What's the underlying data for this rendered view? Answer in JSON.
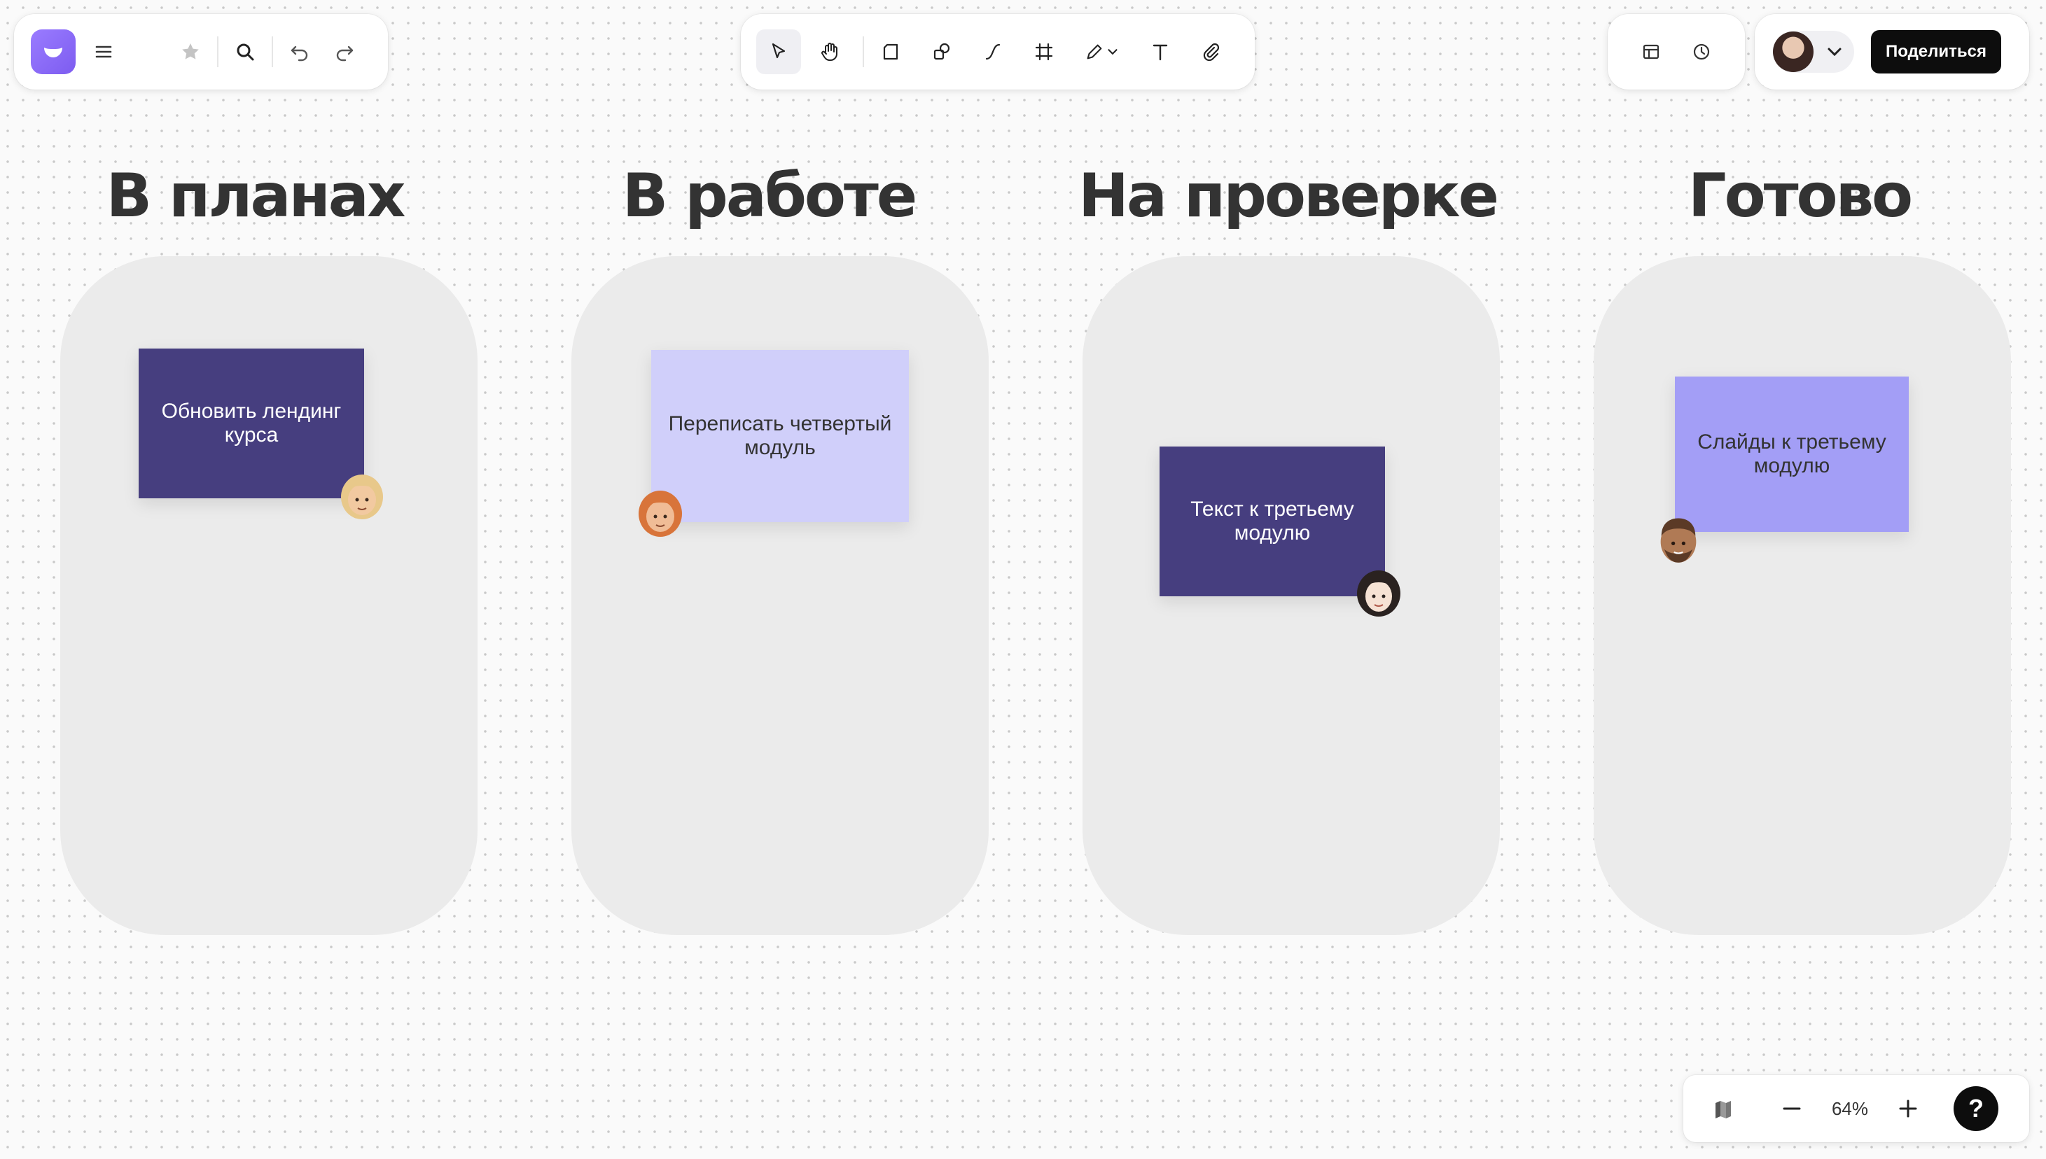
{
  "toolbar_left": {
    "logo_icon": "app-logo-icon",
    "menu_icon": "hamburger-menu-icon",
    "favorite_icon": "star-icon",
    "search_icon": "search-icon",
    "undo_icon": "undo-icon",
    "redo_icon": "redo-icon"
  },
  "tools": [
    {
      "icon": "select-cursor-icon",
      "active": true
    },
    {
      "icon": "hand-pan-icon"
    },
    {
      "icon": "sticky-note-icon"
    },
    {
      "icon": "shapes-icon"
    },
    {
      "icon": "connector-line-icon"
    },
    {
      "icon": "frame-icon"
    },
    {
      "icon": "pen-icon",
      "has_dropdown": true
    },
    {
      "icon": "text-icon"
    },
    {
      "icon": "attachment-icon"
    }
  ],
  "toolbar_right": {
    "layout_icon": "layout-panel-icon",
    "history_icon": "clock-history-icon",
    "share_label": "Поделиться"
  },
  "board": {
    "columns": [
      {
        "title": "В планах",
        "card": {
          "text": "Обновить лендинг курса",
          "color": "#463e7f"
        }
      },
      {
        "title": "В работе",
        "card": {
          "text": "Переписать четвертый модуль",
          "color": "#d0cffa"
        }
      },
      {
        "title": "На проверке",
        "card": {
          "text": "Текст к третьему модулю",
          "color": "#463e7f"
        }
      },
      {
        "title": "Готово",
        "card": {
          "text": "Слайды к третьему модулю",
          "color": "#a39ef6"
        }
      }
    ]
  },
  "zoom": {
    "level": "64%",
    "help_label": "?"
  },
  "colors": {
    "accent": "#7d5cf0",
    "column_bg": "#ebebeb",
    "share_button": "#0d0d0d"
  }
}
